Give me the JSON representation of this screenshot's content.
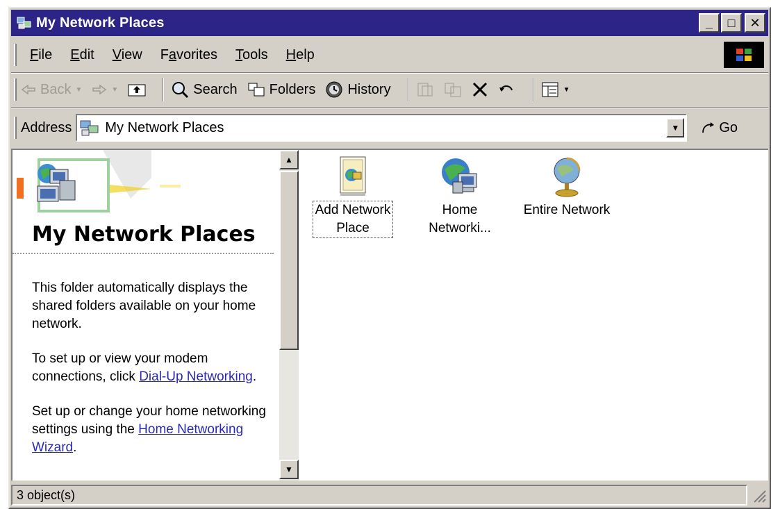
{
  "window": {
    "title": "My Network Places",
    "controls": {
      "minimize": "_",
      "maximize": "□",
      "close": "✕"
    }
  },
  "menu": [
    {
      "label": "File",
      "accel": "F"
    },
    {
      "label": "Edit",
      "accel": "E"
    },
    {
      "label": "View",
      "accel": "V"
    },
    {
      "label": "Favorites",
      "accel": "a"
    },
    {
      "label": "Tools",
      "accel": "T"
    },
    {
      "label": "Help",
      "accel": "H"
    }
  ],
  "toolbar": {
    "back_label": "Back",
    "search_label": "Search",
    "folders_label": "Folders",
    "history_label": "History"
  },
  "address": {
    "label": "Address",
    "value": "My Network Places",
    "go_label": "Go"
  },
  "left_pane": {
    "title": "My Network Places",
    "para1": "This folder automatically displays the shared folders available on your home network.",
    "para2_text": "To set up or view your modem connections, click ",
    "para2_link": "Dial-Up Networking",
    "para2_end": ".",
    "para3_text": "Set up or change your home networking settings using the ",
    "para3_link": "Home Networking Wizard",
    "para3_end": "."
  },
  "items": [
    {
      "label_line1": "Add Network",
      "label_line2": "Place",
      "icon": "add-network-place-icon",
      "selected": true
    },
    {
      "label_line1": "Home",
      "label_line2": "Networki...",
      "icon": "home-network-icon",
      "selected": false
    },
    {
      "label_line1": "Entire Network",
      "label_line2": "",
      "icon": "entire-network-icon",
      "selected": false
    }
  ],
  "status": {
    "text": "3 object(s)"
  },
  "colors": {
    "title_bar": "#2c2486",
    "face": "#d4d0c8",
    "link": "#2a2ab0"
  }
}
